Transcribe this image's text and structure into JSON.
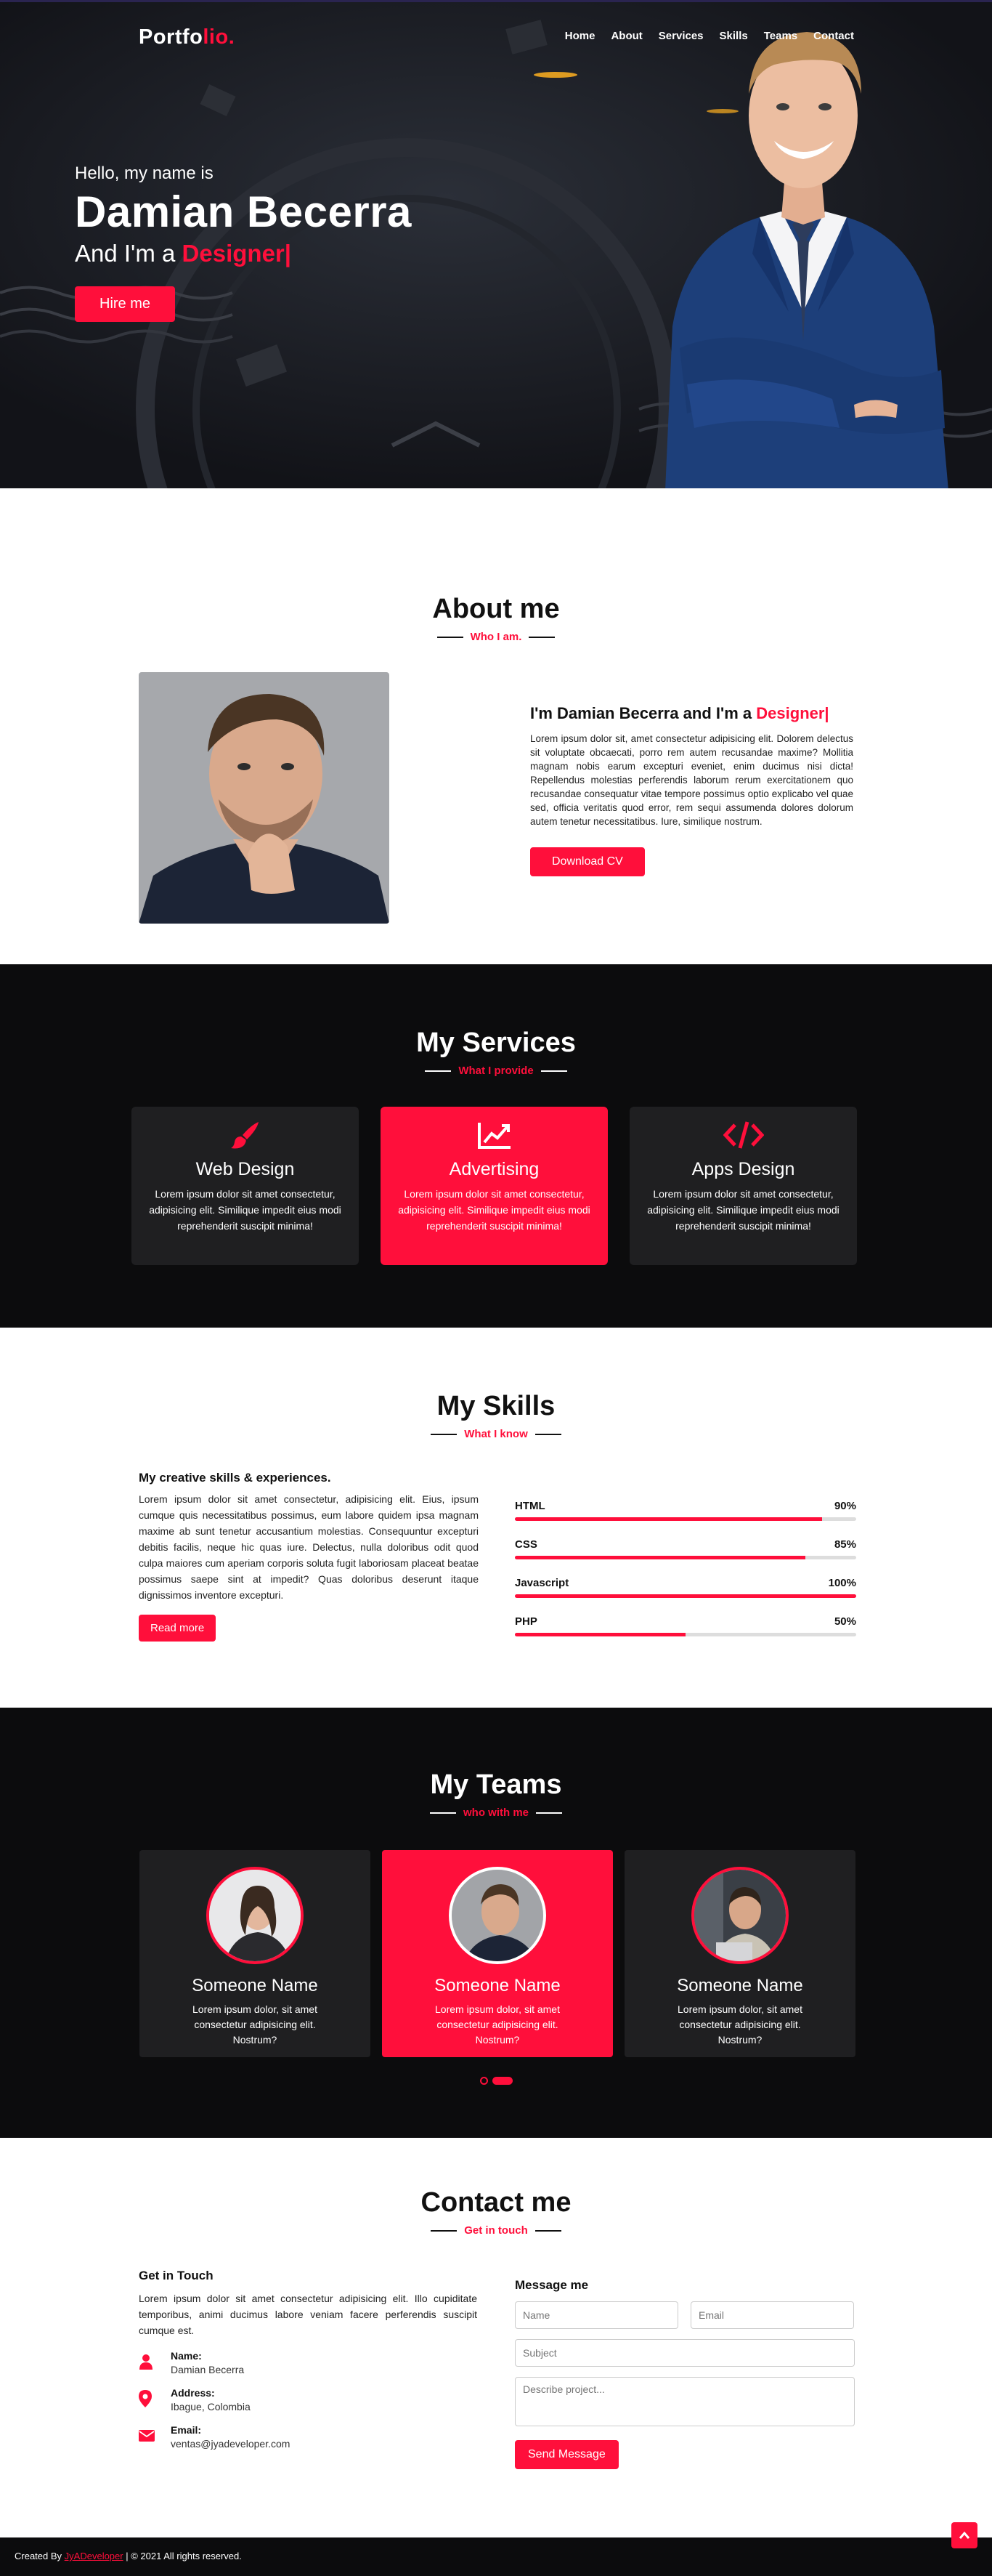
{
  "nav": {
    "logo_main": "Portfo",
    "logo_accent": "lio.",
    "items": [
      "Home",
      "About",
      "Services",
      "Skills",
      "Teams",
      "Contact"
    ]
  },
  "hero": {
    "hello": "Hello, my name is",
    "name": "Damian Becerra",
    "role_prefix": "And I'm a",
    "role_value": "Designer|",
    "hire_label": "Hire me"
  },
  "about": {
    "title": "About me",
    "subtitle": "Who I am.",
    "heading_prefix": "I'm Damian Becerra and I'm a",
    "heading_accent": "Designer|",
    "text": "Lorem ipsum dolor sit, amet consectetur adipisicing elit. Dolorem delectus sit voluptate obcaecati, porro rem autem recusandae maxime? Mollitia magnam nobis earum excepturi eveniet, enim ducimus nisi dicta! Repellendus molestias perferendis laborum rerum exercitationem quo recusandae consequatur vitae tempore possimus optio explicabo vel quae sed, officia veritatis quod error, rem sequi assumenda dolores dolorum autem tenetur necessitatibus. Iure, similique nostrum.",
    "cv_label": "Download CV"
  },
  "services": {
    "title": "My Services",
    "subtitle": "What I provide",
    "items": [
      {
        "title": "Web Design",
        "text": "Lorem ipsum dolor sit amet consectetur, adipisicing elit. Similique impedit eius modi reprehenderit suscipit minima!"
      },
      {
        "title": "Advertising",
        "text": "Lorem ipsum dolor sit amet consectetur, adipisicing elit. Similique impedit eius modi reprehenderit suscipit minima!"
      },
      {
        "title": "Apps Design",
        "text": "Lorem ipsum dolor sit amet consectetur, adipisicing elit. Similique impedit eius modi reprehenderit suscipit minima!"
      }
    ]
  },
  "skills": {
    "title": "My Skills",
    "subtitle": "What I know",
    "heading": "My creative skills & experiences.",
    "text": "Lorem ipsum dolor sit amet consectetur, adipisicing elit. Eius, ipsum cumque quis necessitatibus possimus, eum labore quidem ipsa magnam maxime ab sunt tenetur accusantium molestias. Consequuntur excepturi debitis facilis, neque hic quas iure. Delectus, nulla doloribus odit quod culpa maiores cum aperiam corporis soluta fugit laboriosam placeat beatae possimus saepe sint at impedit? Quas doloribus deserunt itaque dignissimos inventore excepturi.",
    "read_more": "Read more",
    "bars": [
      {
        "name": "HTML",
        "label": "90%",
        "value": 0.9
      },
      {
        "name": "CSS",
        "label": "85%",
        "value": 0.85
      },
      {
        "name": "Javascript",
        "label": "100%",
        "value": 1.0
      },
      {
        "name": "PHP",
        "label": "50%",
        "value": 0.5
      }
    ]
  },
  "teams": {
    "title": "My Teams",
    "subtitle": "who with me",
    "members": [
      {
        "name": "Someone Name",
        "text": "Lorem ipsum dolor, sit amet consectetur adipisicing elit. Nostrum?"
      },
      {
        "name": "Someone Name",
        "text": "Lorem ipsum dolor, sit amet consectetur adipisicing elit. Nostrum?"
      },
      {
        "name": "Someone Name",
        "text": "Lorem ipsum dolor, sit amet consectetur adipisicing elit. Nostrum?"
      }
    ]
  },
  "contact": {
    "title": "Contact me",
    "subtitle": "Get in touch",
    "left_heading": "Get in Touch",
    "left_text": "Lorem ipsum dolor sit amet consectetur adipisicing elit. Illo cupiditate temporibus, animi ducimus labore veniam facere perferendis suscipit cumque est.",
    "name_label": "Name:",
    "name_value": "Damian Becerra",
    "address_label": "Address:",
    "address_value": "Ibague, Colombia",
    "email_label": "Email:",
    "email_value": "ventas@jyadeveloper.com",
    "form_heading": "Message me",
    "ph_name": "Name",
    "ph_email": "Email",
    "ph_subject": "Subject",
    "ph_message": "Describe project...",
    "send_label": "Send Message"
  },
  "footer": {
    "prefix": "Created By",
    "author": "JyADeveloper",
    "suffix": "| © 2021 All rights reserved."
  },
  "colors": {
    "accent": "#ff0f3b",
    "dark": "#0c0c0d",
    "card": "#1f1f21"
  }
}
